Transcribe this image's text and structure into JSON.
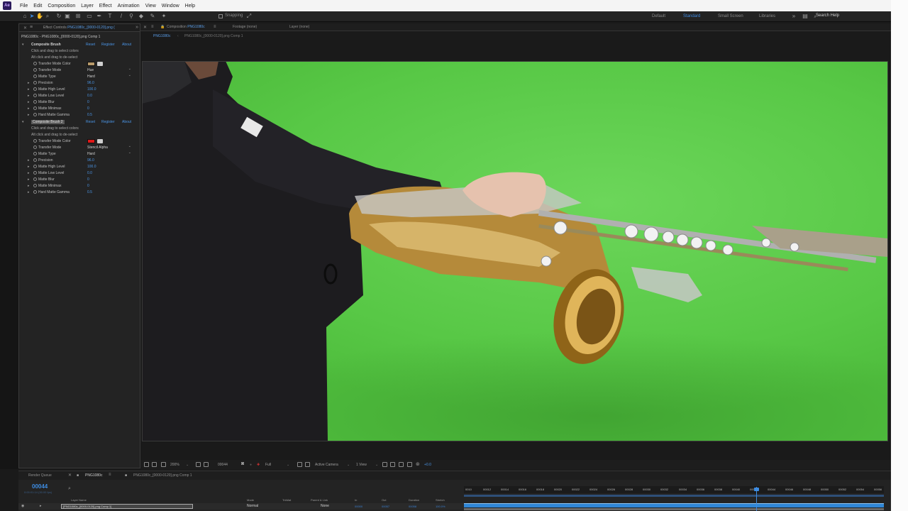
{
  "app": {
    "icon_label": "Ae"
  },
  "menu": [
    "File",
    "Edit",
    "Composition",
    "Layer",
    "Effect",
    "Animation",
    "View",
    "Window",
    "Help"
  ],
  "toolbar": {
    "snapping_label": "Snapping",
    "workspaces": [
      "Default",
      "Standard",
      "Small Screen",
      "Libraries"
    ],
    "active_workspace": "Standard",
    "search_help": "Search Help"
  },
  "effect_panel": {
    "tab_prefix": "Effect Controls",
    "tab_layer": "PNG1080c_[0000-0120].png (",
    "breadcrumb": "PNG1080c - PNG1080c_[0000-0120].png Comp 1",
    "effects": [
      {
        "name": "Composite Brush",
        "selected": false,
        "reset": "Reset",
        "register": "Register",
        "about": "About",
        "notes": [
          "Click and drag to select colors",
          "Alt click and drag to de-select"
        ],
        "color_label": "Transfer Mode Color",
        "color": "#b89a6a",
        "params": [
          {
            "label": "Transfer Mode",
            "value": "Hue",
            "dropdown": true,
            "expand": false
          },
          {
            "label": "Matte Type",
            "value": "Hard",
            "dropdown": true,
            "expand": false
          },
          {
            "label": "Precision",
            "value": "96.0",
            "expand": true
          },
          {
            "label": "Matte High Level",
            "value": "100.0",
            "expand": true
          },
          {
            "label": "Matte Low Level",
            "value": "0.0",
            "expand": true
          },
          {
            "label": "Matte Blur",
            "value": "0",
            "expand": true
          },
          {
            "label": "Matte Minimax",
            "value": "0",
            "expand": true
          },
          {
            "label": "Hard Matte Gamma",
            "value": "0.5",
            "expand": true
          }
        ]
      },
      {
        "name": "Composite Brush 2",
        "selected": true,
        "reset": "Reset",
        "register": "Register",
        "about": "About",
        "notes": [
          "Click and drag to select colors",
          "Alt click and drag to de-select"
        ],
        "color_label": "Transfer Mode Color",
        "color": "#e01818",
        "params": [
          {
            "label": "Transfer Mode",
            "value": "Stencil Alpha",
            "dropdown": true,
            "expand": false
          },
          {
            "label": "Matte Type",
            "value": "Hard",
            "dropdown": true,
            "expand": false
          },
          {
            "label": "Precision",
            "value": "96.0",
            "expand": true
          },
          {
            "label": "Matte High Level",
            "value": "100.0",
            "expand": true
          },
          {
            "label": "Matte Low Level",
            "value": "0.0",
            "expand": true
          },
          {
            "label": "Matte Blur",
            "value": "0",
            "expand": true
          },
          {
            "label": "Matte Minimax",
            "value": "0",
            "expand": true
          },
          {
            "label": "Hard Matte Gamma",
            "value": "0.5",
            "expand": true
          }
        ]
      }
    ]
  },
  "comp_panel": {
    "tab_prefix": "Composition",
    "tab_name": "PNG1080c",
    "footage_tab": "Footage (none)",
    "layer_tab": "Layer (none)",
    "subtabs": [
      "PNG1080c",
      "PNG1080c_[0000-0120].png Comp 1"
    ]
  },
  "viewer_footer": {
    "zoom": "200%",
    "timecode": "00044",
    "resolution": "Full",
    "camera": "Active Camera",
    "views": "1 View",
    "exposure": "+0.0"
  },
  "timeline": {
    "tabs": [
      "Render Queue",
      "PNG1080c",
      "PNG1080c_[0000-0120].png Comp 1"
    ],
    "active_tab": "PNG1080c",
    "timecode": "00044",
    "timecode_sub": "0:00:01:14 (30.00 fps)",
    "columns": [
      "Layer Name",
      "Mode",
      "TrkMat",
      "Parent & Link",
      "In",
      "Out",
      "Duration",
      "Stretch"
    ],
    "layer": {
      "name": "[PNG1080c_[0000-0120].png Comp 1]",
      "mode": "Normal",
      "parent": "None",
      "in": "00000",
      "out": "00057",
      "duration": "00058",
      "stretch": "100.0%"
    },
    "ruler": [
      "0010",
      "00012",
      "00014",
      "00016",
      "00018",
      "00020",
      "00022",
      "00024",
      "00026",
      "00028",
      "00030",
      "00032",
      "00034",
      "00036",
      "00038",
      "00040",
      "00042",
      "00044",
      "00046",
      "00048",
      "00050",
      "00052",
      "00054",
      "00056"
    ]
  }
}
